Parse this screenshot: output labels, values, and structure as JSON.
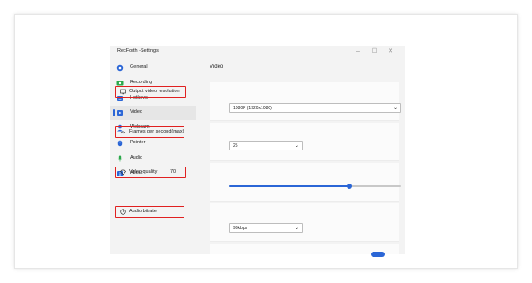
{
  "window": {
    "title": "RecForth -Settings",
    "controls": {
      "minimize": "–",
      "maximize": "☐",
      "close": "✕"
    }
  },
  "sidebar": {
    "items": [
      {
        "label": "General",
        "icon": "general-icon",
        "color": "#2b66d6",
        "active": false
      },
      {
        "label": "Recording",
        "icon": "recording-icon",
        "color": "#2aa84a",
        "active": false
      },
      {
        "label": "Hotkeys",
        "icon": "hotkeys-icon",
        "color": "#2b66d6",
        "active": false
      },
      {
        "label": "Video",
        "icon": "video-icon",
        "color": "#2b66d6",
        "active": true
      },
      {
        "label": "Webcam",
        "icon": "webcam-icon",
        "color": "#2b66d6",
        "active": false
      },
      {
        "label": "Pointer",
        "icon": "pointer-icon",
        "color": "#2b66d6",
        "active": false
      },
      {
        "label": "Audio",
        "icon": "audio-icon",
        "color": "#2aa84a",
        "active": false
      },
      {
        "label": "About",
        "icon": "about-icon",
        "color": "#2b66d6",
        "active": false
      }
    ]
  },
  "main": {
    "title": "Video",
    "output_resolution": {
      "label": "Output video resolution",
      "value": "1080P (1920x1080)"
    },
    "frames_per_second": {
      "label": "Frames per second(max)",
      "value": "25"
    },
    "video_quality": {
      "label": "Video quality",
      "value": "70",
      "level_percent": 70
    },
    "audio_bitrate": {
      "label": "Audio bitrate",
      "value": "96kbps"
    }
  },
  "colors": {
    "accent": "#2b66d6",
    "highlight": "#e02020"
  }
}
